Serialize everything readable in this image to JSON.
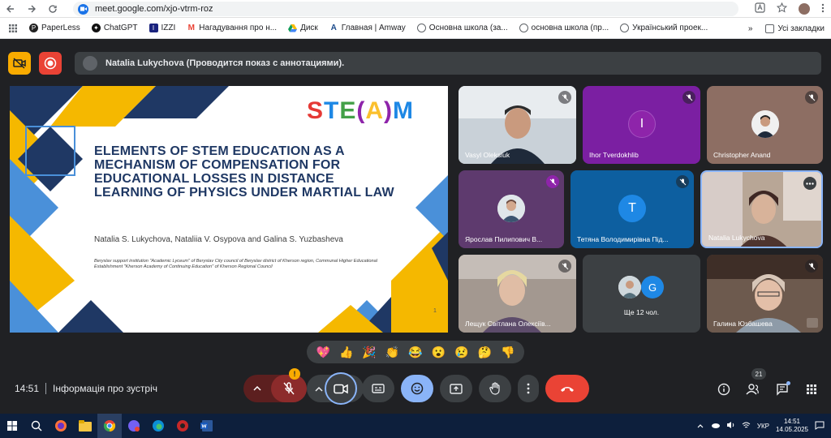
{
  "browser": {
    "url": "meet.google.com/xjo-vtrm-roz",
    "bookmarks": [
      "PaperLess",
      "ChatGPT",
      "IZZI",
      "Нагадування про н...",
      "Диск",
      "Главная | Amway",
      "Основна школа (за...",
      "основна школа (пр...",
      "Український проек..."
    ],
    "all_bookmarks": "Усі закладки"
  },
  "meet": {
    "presenter_banner": "Natalia Lukychova (Проводится показ с аннотациями).",
    "slide": {
      "logo": [
        "S",
        "T",
        "E",
        "(",
        "A",
        ")",
        "M"
      ],
      "logo_colors": [
        "#e53935",
        "#1e88e5",
        "#43a047",
        "#8e24aa",
        "#fbc02d",
        "#8e24aa",
        "#1e88e5"
      ],
      "title": "ELEMENTS OF STEM EDUCATION AS A MECHANISM OF COMPENSATION FOR EDUCATIONAL LOSSES IN DISTANCE LEARNING OF PHYSICS UNDER MARTIAL LAW",
      "authors": "Natalia S. Lukychova, Nataliia V. Osypova and Galina S. Yuzbasheva",
      "affiliation": "Beryslav support institution \"Academic Lyceum\" of Beryslav City council of Beryslav district of Kherson region, Communal Higher Educational Establishment \"Kherson Academy of Continuing Education\" of Kherson Regional Council",
      "page": "1"
    },
    "participants": [
      {
        "name": "Vasyl Oleksiuk"
      },
      {
        "name": "Ihor Tverdokhlib",
        "initial": "I"
      },
      {
        "name": "Christopher Anand"
      },
      {
        "name": "Ярослав Пилипович В..."
      },
      {
        "name": "Тетяна Володимирівна Під...",
        "initial": "T"
      },
      {
        "name": "Natalia Lukychova"
      },
      {
        "name": "Лещук Світлана Олексіїв..."
      },
      {
        "name": "Ще 12 чол.",
        "initial": "G"
      },
      {
        "name": "Галина Юзбашева"
      }
    ],
    "reactions": [
      "💖",
      "👍",
      "🎉",
      "👏",
      "😂",
      "😮",
      "😢",
      "🤔",
      "👎"
    ],
    "time": "14:51",
    "meeting_info": "Інформація про зустріч",
    "people_count": "21",
    "colors": {
      "end_call": "#ea4335",
      "accent": "#8ab4f8",
      "rec": "#ea4335",
      "cam_off": "#f9ab00"
    }
  },
  "taskbar": {
    "lang": "УКР",
    "time": "14:51",
    "date": "14.05.2025"
  }
}
